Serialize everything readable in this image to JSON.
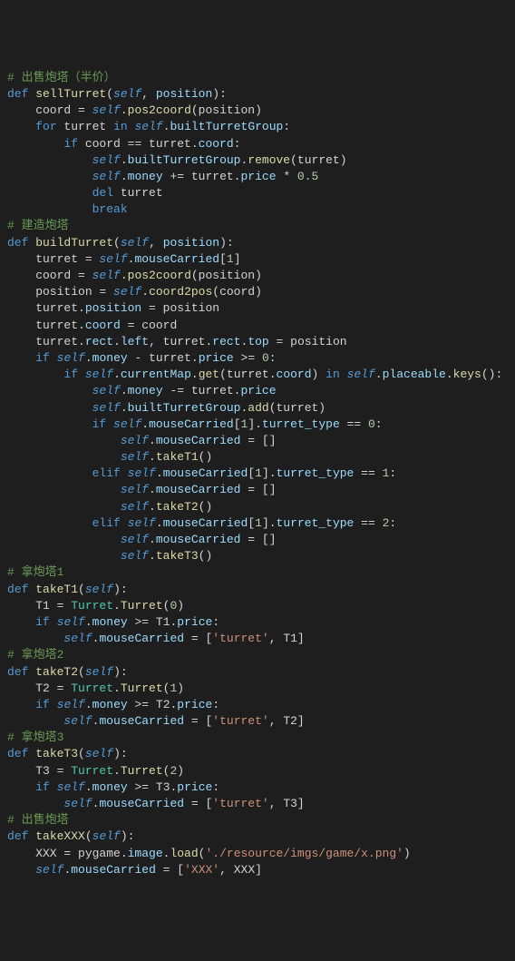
{
  "lines": [
    {
      "cls": "cm",
      "html": "# 出售炮塔（半价）"
    },
    {
      "cls": "",
      "html": "<span class='kw'>def</span> <span class='fn'>sellTurret</span>(<span class='sf'>self</span>, <span class='pr'>position</span>):"
    },
    {
      "cls": "",
      "html": "    coord = <span class='sf'>self</span>.<span class='fn'>pos2coord</span>(position)"
    },
    {
      "cls": "",
      "html": "    <span class='kw'>for</span> turret <span class='kw'>in</span> <span class='sf'>self</span>.<span class='pr'>builtTurretGroup</span>:"
    },
    {
      "cls": "",
      "html": "        <span class='kw'>if</span> coord == turret.<span class='pr'>coord</span>:"
    },
    {
      "cls": "",
      "html": "            <span class='sf'>self</span>.<span class='pr'>builtTurretGroup</span>.<span class='fn'>remove</span>(turret)"
    },
    {
      "cls": "",
      "html": "            <span class='sf'>self</span>.<span class='pr'>money</span> += turret.<span class='pr'>price</span> * <span class='nm'>0.5</span>"
    },
    {
      "cls": "",
      "html": "            <span class='kw'>del</span> turret"
    },
    {
      "cls": "",
      "html": "            <span class='kw'>break</span>"
    },
    {
      "cls": "cm",
      "html": "# 建造炮塔"
    },
    {
      "cls": "",
      "html": "<span class='kw'>def</span> <span class='fn'>buildTurret</span>(<span class='sf'>self</span>, <span class='pr'>position</span>):"
    },
    {
      "cls": "",
      "html": "    turret = <span class='sf'>self</span>.<span class='pr'>mouseCarried</span>[<span class='nm'>1</span>]"
    },
    {
      "cls": "",
      "html": "    coord = <span class='sf'>self</span>.<span class='fn'>pos2coord</span>(position)"
    },
    {
      "cls": "",
      "html": "    position = <span class='sf'>self</span>.<span class='fn'>coord2pos</span>(coord)"
    },
    {
      "cls": "",
      "html": "    turret.<span class='pr'>position</span> = position"
    },
    {
      "cls": "",
      "html": "    turret.<span class='pr'>coord</span> = coord"
    },
    {
      "cls": "",
      "html": "    turret.<span class='pr'>rect</span>.<span class='pr'>left</span>, turret.<span class='pr'>rect</span>.<span class='pr'>top</span> = position"
    },
    {
      "cls": "",
      "html": "    <span class='kw'>if</span> <span class='sf'>self</span>.<span class='pr'>money</span> - turret.<span class='pr'>price</span> &gt;= <span class='nm'>0</span>:"
    },
    {
      "cls": "",
      "html": "        <span class='kw'>if</span> <span class='sf'>self</span>.<span class='pr'>currentMap</span>.<span class='fn'>get</span>(turret.<span class='pr'>coord</span>) <span class='kw'>in</span> <span class='sf'>self</span>.<span class='pr'>placeable</span>.<span class='fn'>keys</span>():"
    },
    {
      "cls": "",
      "html": "            <span class='sf'>self</span>.<span class='pr'>money</span> -= turret.<span class='pr'>price</span>"
    },
    {
      "cls": "",
      "html": "            <span class='sf'>self</span>.<span class='pr'>builtTurretGroup</span>.<span class='fn'>add</span>(turret)"
    },
    {
      "cls": "",
      "html": "            <span class='kw'>if</span> <span class='sf'>self</span>.<span class='pr'>mouseCarried</span>[<span class='nm'>1</span>].<span class='pr'>turret_type</span> == <span class='nm'>0</span>:"
    },
    {
      "cls": "",
      "html": "                <span class='sf'>self</span>.<span class='pr'>mouseCarried</span> = []"
    },
    {
      "cls": "",
      "html": "                <span class='sf'>self</span>.<span class='fn'>takeT1</span>()"
    },
    {
      "cls": "",
      "html": "            <span class='kw'>elif</span> <span class='sf'>self</span>.<span class='pr'>mouseCarried</span>[<span class='nm'>1</span>].<span class='pr'>turret_type</span> == <span class='nm'>1</span>:"
    },
    {
      "cls": "",
      "html": "                <span class='sf'>self</span>.<span class='pr'>mouseCarried</span> = []"
    },
    {
      "cls": "",
      "html": "                <span class='sf'>self</span>.<span class='fn'>takeT2</span>()"
    },
    {
      "cls": "",
      "html": "            <span class='kw'>elif</span> <span class='sf'>self</span>.<span class='pr'>mouseCarried</span>[<span class='nm'>1</span>].<span class='pr'>turret_type</span> == <span class='nm'>2</span>:"
    },
    {
      "cls": "",
      "html": "                <span class='sf'>self</span>.<span class='pr'>mouseCarried</span> = []"
    },
    {
      "cls": "",
      "html": "                <span class='sf'>self</span>.<span class='fn'>takeT3</span>()"
    },
    {
      "cls": "cm",
      "html": "# 拿炮塔1"
    },
    {
      "cls": "",
      "html": "<span class='kw'>def</span> <span class='fn'>takeT1</span>(<span class='sf'>self</span>):"
    },
    {
      "cls": "",
      "html": "    T1 = <span class='cl'>Turret</span>.<span class='fn'>Turret</span>(<span class='nm'>0</span>)"
    },
    {
      "cls": "",
      "html": "    <span class='kw'>if</span> <span class='sf'>self</span>.<span class='pr'>money</span> &gt;= T1.<span class='pr'>price</span>:"
    },
    {
      "cls": "",
      "html": "        <span class='sf'>self</span>.<span class='pr'>mouseCarried</span> = [<span class='st'>'turret'</span>, T1]"
    },
    {
      "cls": "cm",
      "html": "# 拿炮塔2"
    },
    {
      "cls": "",
      "html": "<span class='kw'>def</span> <span class='fn'>takeT2</span>(<span class='sf'>self</span>):"
    },
    {
      "cls": "",
      "html": "    T2 = <span class='cl'>Turret</span>.<span class='fn'>Turret</span>(<span class='nm'>1</span>)"
    },
    {
      "cls": "",
      "html": "    <span class='kw'>if</span> <span class='sf'>self</span>.<span class='pr'>money</span> &gt;= T2.<span class='pr'>price</span>:"
    },
    {
      "cls": "",
      "html": "        <span class='sf'>self</span>.<span class='pr'>mouseCarried</span> = [<span class='st'>'turret'</span>, T2]"
    },
    {
      "cls": "cm",
      "html": "# 拿炮塔3"
    },
    {
      "cls": "",
      "html": "<span class='kw'>def</span> <span class='fn'>takeT3</span>(<span class='sf'>self</span>):"
    },
    {
      "cls": "",
      "html": "    T3 = <span class='cl'>Turret</span>.<span class='fn'>Turret</span>(<span class='nm'>2</span>)"
    },
    {
      "cls": "",
      "html": "    <span class='kw'>if</span> <span class='sf'>self</span>.<span class='pr'>money</span> &gt;= T3.<span class='pr'>price</span>:"
    },
    {
      "cls": "",
      "html": "        <span class='sf'>self</span>.<span class='pr'>mouseCarried</span> = [<span class='st'>'turret'</span>, T3]"
    },
    {
      "cls": "cm",
      "html": "# 出售炮塔"
    },
    {
      "cls": "",
      "html": "<span class='kw'>def</span> <span class='fn'>takeXXX</span>(<span class='sf'>self</span>):"
    },
    {
      "cls": "",
      "html": "    XXX = pygame.<span class='pr'>image</span>.<span class='fn'>load</span>(<span class='st'>'./resource/imgs/game/x.png'</span>)"
    },
    {
      "cls": "",
      "html": "    <span class='sf'>self</span>.<span class='pr'>mouseCarried</span> = [<span class='st'>'XXX'</span>, XXX]"
    }
  ]
}
